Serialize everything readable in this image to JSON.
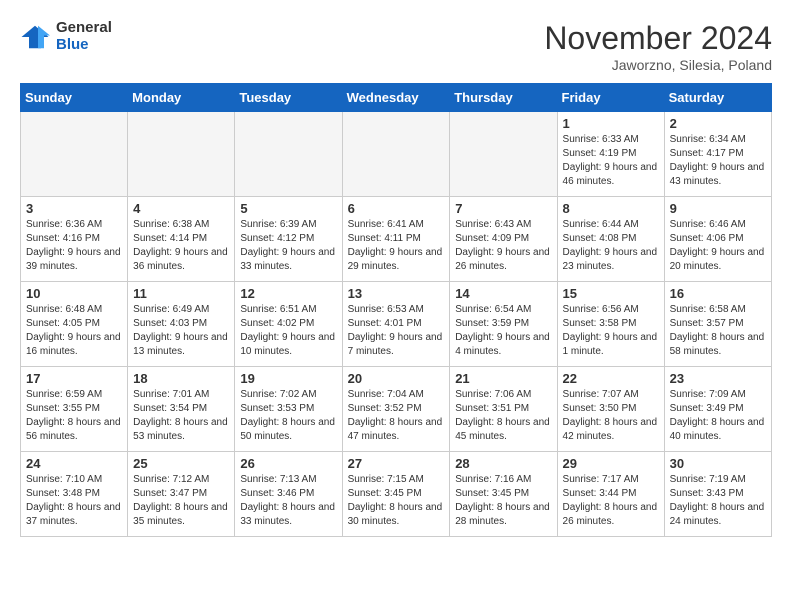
{
  "logo": {
    "general": "General",
    "blue": "Blue"
  },
  "title": "November 2024",
  "location": "Jaworzno, Silesia, Poland",
  "days_of_week": [
    "Sunday",
    "Monday",
    "Tuesday",
    "Wednesday",
    "Thursday",
    "Friday",
    "Saturday"
  ],
  "weeks": [
    [
      {
        "day": "",
        "info": ""
      },
      {
        "day": "",
        "info": ""
      },
      {
        "day": "",
        "info": ""
      },
      {
        "day": "",
        "info": ""
      },
      {
        "day": "",
        "info": ""
      },
      {
        "day": "1",
        "info": "Sunrise: 6:33 AM\nSunset: 4:19 PM\nDaylight: 9 hours and 46 minutes."
      },
      {
        "day": "2",
        "info": "Sunrise: 6:34 AM\nSunset: 4:17 PM\nDaylight: 9 hours and 43 minutes."
      }
    ],
    [
      {
        "day": "3",
        "info": "Sunrise: 6:36 AM\nSunset: 4:16 PM\nDaylight: 9 hours and 39 minutes."
      },
      {
        "day": "4",
        "info": "Sunrise: 6:38 AM\nSunset: 4:14 PM\nDaylight: 9 hours and 36 minutes."
      },
      {
        "day": "5",
        "info": "Sunrise: 6:39 AM\nSunset: 4:12 PM\nDaylight: 9 hours and 33 minutes."
      },
      {
        "day": "6",
        "info": "Sunrise: 6:41 AM\nSunset: 4:11 PM\nDaylight: 9 hours and 29 minutes."
      },
      {
        "day": "7",
        "info": "Sunrise: 6:43 AM\nSunset: 4:09 PM\nDaylight: 9 hours and 26 minutes."
      },
      {
        "day": "8",
        "info": "Sunrise: 6:44 AM\nSunset: 4:08 PM\nDaylight: 9 hours and 23 minutes."
      },
      {
        "day": "9",
        "info": "Sunrise: 6:46 AM\nSunset: 4:06 PM\nDaylight: 9 hours and 20 minutes."
      }
    ],
    [
      {
        "day": "10",
        "info": "Sunrise: 6:48 AM\nSunset: 4:05 PM\nDaylight: 9 hours and 16 minutes."
      },
      {
        "day": "11",
        "info": "Sunrise: 6:49 AM\nSunset: 4:03 PM\nDaylight: 9 hours and 13 minutes."
      },
      {
        "day": "12",
        "info": "Sunrise: 6:51 AM\nSunset: 4:02 PM\nDaylight: 9 hours and 10 minutes."
      },
      {
        "day": "13",
        "info": "Sunrise: 6:53 AM\nSunset: 4:01 PM\nDaylight: 9 hours and 7 minutes."
      },
      {
        "day": "14",
        "info": "Sunrise: 6:54 AM\nSunset: 3:59 PM\nDaylight: 9 hours and 4 minutes."
      },
      {
        "day": "15",
        "info": "Sunrise: 6:56 AM\nSunset: 3:58 PM\nDaylight: 9 hours and 1 minute."
      },
      {
        "day": "16",
        "info": "Sunrise: 6:58 AM\nSunset: 3:57 PM\nDaylight: 8 hours and 58 minutes."
      }
    ],
    [
      {
        "day": "17",
        "info": "Sunrise: 6:59 AM\nSunset: 3:55 PM\nDaylight: 8 hours and 56 minutes."
      },
      {
        "day": "18",
        "info": "Sunrise: 7:01 AM\nSunset: 3:54 PM\nDaylight: 8 hours and 53 minutes."
      },
      {
        "day": "19",
        "info": "Sunrise: 7:02 AM\nSunset: 3:53 PM\nDaylight: 8 hours and 50 minutes."
      },
      {
        "day": "20",
        "info": "Sunrise: 7:04 AM\nSunset: 3:52 PM\nDaylight: 8 hours and 47 minutes."
      },
      {
        "day": "21",
        "info": "Sunrise: 7:06 AM\nSunset: 3:51 PM\nDaylight: 8 hours and 45 minutes."
      },
      {
        "day": "22",
        "info": "Sunrise: 7:07 AM\nSunset: 3:50 PM\nDaylight: 8 hours and 42 minutes."
      },
      {
        "day": "23",
        "info": "Sunrise: 7:09 AM\nSunset: 3:49 PM\nDaylight: 8 hours and 40 minutes."
      }
    ],
    [
      {
        "day": "24",
        "info": "Sunrise: 7:10 AM\nSunset: 3:48 PM\nDaylight: 8 hours and 37 minutes."
      },
      {
        "day": "25",
        "info": "Sunrise: 7:12 AM\nSunset: 3:47 PM\nDaylight: 8 hours and 35 minutes."
      },
      {
        "day": "26",
        "info": "Sunrise: 7:13 AM\nSunset: 3:46 PM\nDaylight: 8 hours and 33 minutes."
      },
      {
        "day": "27",
        "info": "Sunrise: 7:15 AM\nSunset: 3:45 PM\nDaylight: 8 hours and 30 minutes."
      },
      {
        "day": "28",
        "info": "Sunrise: 7:16 AM\nSunset: 3:45 PM\nDaylight: 8 hours and 28 minutes."
      },
      {
        "day": "29",
        "info": "Sunrise: 7:17 AM\nSunset: 3:44 PM\nDaylight: 8 hours and 26 minutes."
      },
      {
        "day": "30",
        "info": "Sunrise: 7:19 AM\nSunset: 3:43 PM\nDaylight: 8 hours and 24 minutes."
      }
    ]
  ]
}
